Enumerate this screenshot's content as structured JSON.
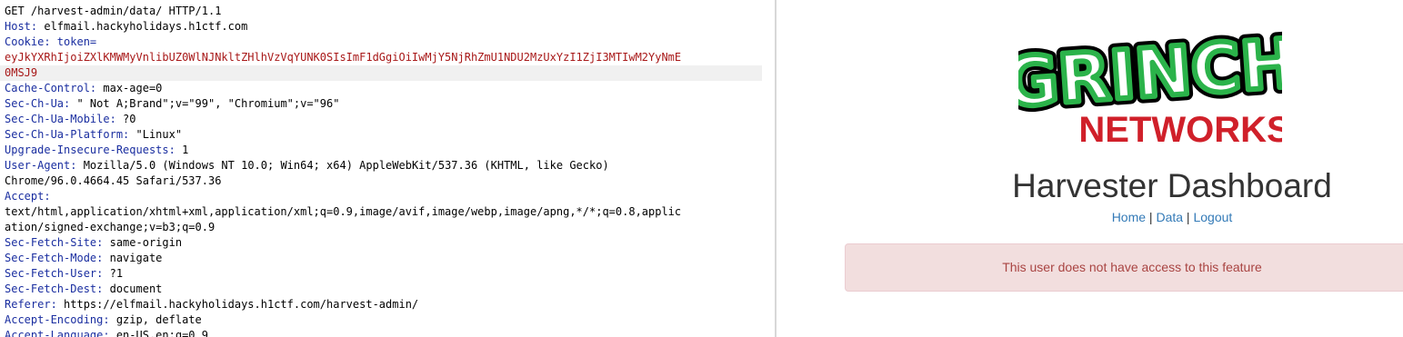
{
  "request": {
    "request_line": "GET /harvest-admin/data/ HTTP/1.1",
    "host_key": "Host:",
    "host_val": " elfmail.hackyholidays.h1ctf.com",
    "cookie_key": "Cookie:",
    "cookie_name": " token=",
    "token_line1": "eyJkYXRhIjoiZXlKMWMyVnlibUZ0WlNJNkltZHlhVzVqYUNK0SIsImF1dGgiOiIwMjY5NjRhZmU1NDU2MzUxYzI1ZjI3MTIwM2YyNmE",
    "token_line2": "0MSJ9",
    "cache_key": "Cache-Control:",
    "cache_val": " max-age=0",
    "sec_ch_ua_key": "Sec-Ch-Ua:",
    "sec_ch_ua_val": " \" Not A;Brand\";v=\"99\", \"Chromium\";v=\"96\"",
    "sec_ch_ua_mobile_key": "Sec-Ch-Ua-Mobile:",
    "sec_ch_ua_mobile_val": " ?0",
    "sec_ch_ua_platform_key": "Sec-Ch-Ua-Platform:",
    "sec_ch_ua_platform_val": " \"Linux\"",
    "uir_key": "Upgrade-Insecure-Requests:",
    "uir_val": " 1",
    "ua_key": "User-Agent:",
    "ua_val": " Mozilla/5.0 (Windows NT 10.0; Win64; x64) AppleWebKit/537.36 (KHTML, like Gecko)",
    "ua_cont": "Chrome/96.0.4664.45 Safari/537.36",
    "accept_key": "Accept:",
    "accept_val1": "text/html,application/xhtml+xml,application/xml;q=0.9,image/avif,image/webp,image/apng,*/*;q=0.8,applic",
    "accept_val2": "ation/signed-exchange;v=b3;q=0.9",
    "sfs_key": "Sec-Fetch-Site:",
    "sfs_val": " same-origin",
    "sfm_key": "Sec-Fetch-Mode:",
    "sfm_val": " navigate",
    "sfu_key": "Sec-Fetch-User:",
    "sfu_val": " ?1",
    "sfd_key": "Sec-Fetch-Dest:",
    "sfd_val": " document",
    "referer_key": "Referer:",
    "referer_val": " https://elfmail.hackyholidays.h1ctf.com/harvest-admin/",
    "ae_key": "Accept-Encoding:",
    "ae_val": " gzip, deflate",
    "al_key": "Accept-Language:",
    "al_val": " en-US,en;q=0.9"
  },
  "response": {
    "logo_word1": "GRINCH",
    "logo_word2": "NETWORKS",
    "title": "Harvester Dashboard",
    "nav": {
      "home": "Home",
      "data": "Data",
      "logout": "Logout",
      "sep": " | "
    },
    "alert": "This user does not have access to this feature"
  },
  "colors": {
    "header_key": "#1a2ea0",
    "token_value": "#a81818",
    "link": "#337ab7",
    "alert_bg": "#f2dede",
    "alert_text": "#a94442",
    "logo_green": "#2bb34a",
    "logo_red": "#d0202a"
  }
}
